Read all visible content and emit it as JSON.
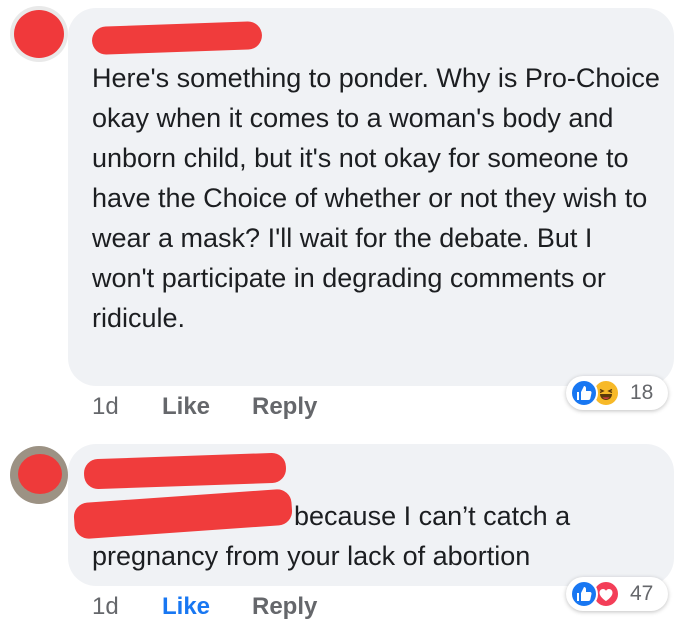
{
  "comments": [
    {
      "text": "Here's something to ponder. Why is Pro-Choice okay when it comes to a woman's body and unborn child, but it's not okay for someone to have the Choice of whether or not they wish to wear a mask? I'll wait for the debate. But I won't participate in degrading comments or ridicule.",
      "time": "1d",
      "like_label": "Like",
      "reply_label": "Reply",
      "reaction_count": "18",
      "reaction_icons": [
        "like-icon",
        "haha-icon"
      ],
      "like_active": false
    },
    {
      "text_line1": "because I can’t catch a",
      "text_line2": "pregnancy from your lack of abortion",
      "time": "1d",
      "like_label": "Like",
      "reply_label": "Reply",
      "reaction_count": "47",
      "reaction_icons": [
        "like-icon",
        "love-icon"
      ],
      "like_active": true
    }
  ],
  "colors": {
    "bubble": "#f0f2f5",
    "redaction": "#f03c3c",
    "like_blue": "#1877f2",
    "love_red": "#f33e58",
    "haha_yellow": "#f7b928",
    "meta_gray": "#65676b"
  }
}
